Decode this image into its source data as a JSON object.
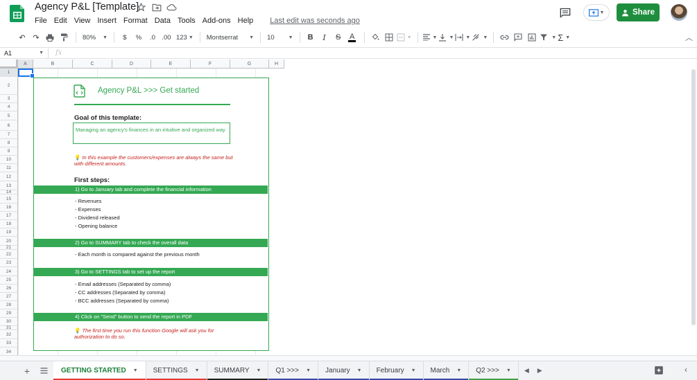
{
  "doc": {
    "title": "Agency P&L [Template]"
  },
  "menu": [
    "File",
    "Edit",
    "View",
    "Insert",
    "Format",
    "Data",
    "Tools",
    "Add-ons",
    "Help"
  ],
  "last_edit": "Last edit was seconds ago",
  "share_label": "Share",
  "toolbar": {
    "zoom": "80%",
    "currency": "$",
    "percent": "%",
    "dec_less": ".0",
    "dec_more": ".00",
    "more_formats": "123",
    "font": "Montserrat",
    "font_size": "10"
  },
  "namebox": "A1",
  "fx": "fx",
  "columns": [
    "A",
    "B",
    "C",
    "D",
    "E",
    "F",
    "G",
    "H"
  ],
  "rows": [
    "1",
    "2",
    "3",
    "4",
    "5",
    "6",
    "7",
    "8",
    "9",
    "10",
    "11",
    "12",
    "13",
    "14",
    "15",
    "16",
    "17",
    "18",
    "19",
    "20",
    "21",
    "22",
    "23",
    "24",
    "25",
    "26",
    "27",
    "28",
    "29",
    "30",
    "31",
    "32",
    "33",
    "34"
  ],
  "card": {
    "title": "Agency P&L >>> Get started",
    "goal_heading": "Goal of this template:",
    "goal_text": "Managing an agency's finances in an intuitive and organized way",
    "note1": "In this example the customers/expenses are always the same but with different amounts.",
    "first_steps": "First steps:",
    "step1": "1) Go to January tab and complete the financial information",
    "step1_items": [
      "- Revenues",
      "- Expenses",
      "- Dividend released",
      "- Opening balance"
    ],
    "step2": "2) Go to SUMMARY tab to check the overall data",
    "step2_items": [
      "- Each month is compared against the previous month"
    ],
    "step3": "3) Go to SETTINGS tab to set up the report",
    "step3_items": [
      "- Email addresses (Separated by comma)",
      "- CC addresses (Separated by comma)",
      "- BCC addresses (Separated by comma)"
    ],
    "step4": "4) Click on \"Send\" button to send the report in PDF",
    "note2": "The first time you run this function Google will ask you for authorization to do so."
  },
  "sheets": [
    {
      "label": "GETTING STARTED",
      "color": "#e53935",
      "active": true
    },
    {
      "label": "SETTINGS",
      "color": "#e53935"
    },
    {
      "label": "SUMMARY",
      "color": "#212121"
    },
    {
      "label": "Q1 >>>",
      "color": "#3949ab"
    },
    {
      "label": "January",
      "color": "#3949ab"
    },
    {
      "label": "February",
      "color": "#3949ab"
    },
    {
      "label": "March",
      "color": "#3949ab"
    },
    {
      "label": "Q2 >>>",
      "color": "#43a047"
    }
  ],
  "colors": {
    "accent": "#34a853",
    "share": "#1e8e3e",
    "note": "#c5221f",
    "selection": "#1a73e8"
  }
}
